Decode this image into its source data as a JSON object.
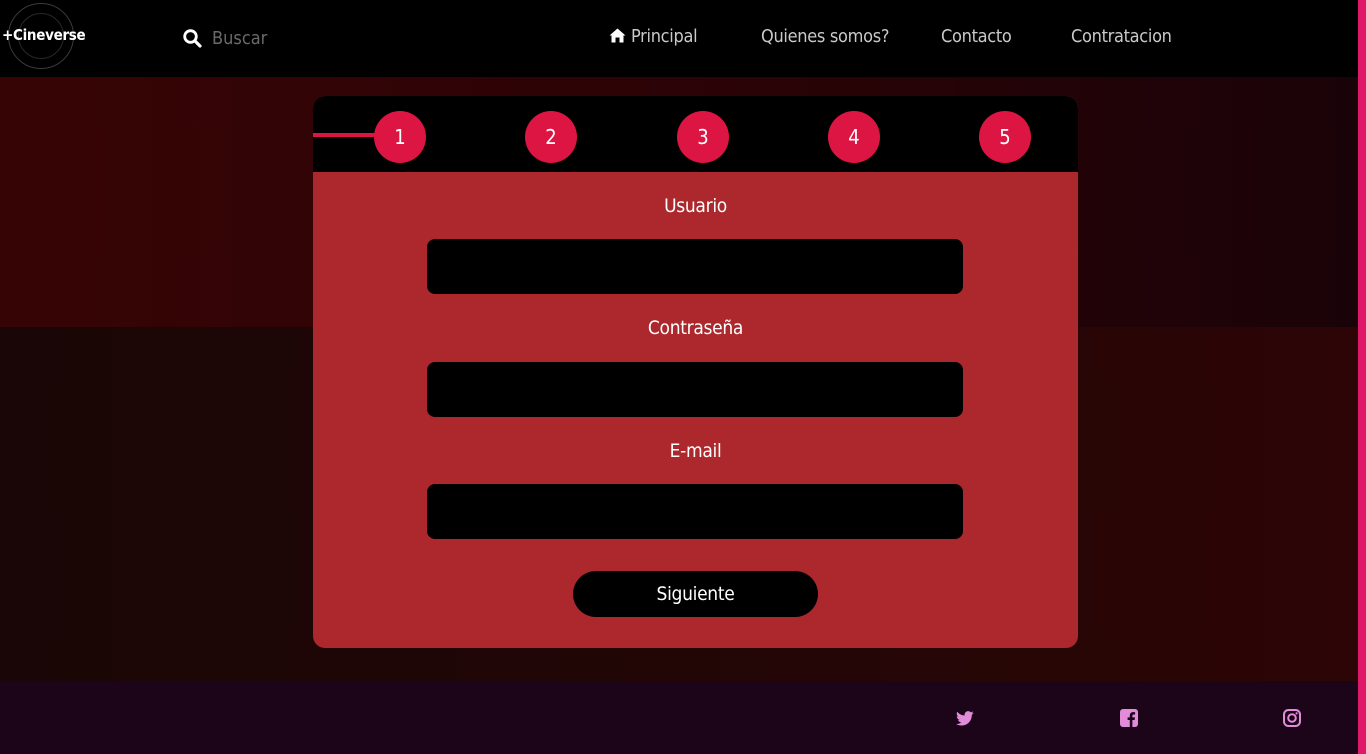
{
  "brand": {
    "logo_text": "+Cineverse"
  },
  "search": {
    "placeholder": "Buscar"
  },
  "nav": {
    "home": "Principal",
    "about": "Quienes somos?",
    "contact": "Contacto",
    "hire": "Contratacion"
  },
  "steps": [
    "1",
    "2",
    "3",
    "4",
    "5"
  ],
  "current_step": 1,
  "form": {
    "user_label": "Usuario",
    "user_value": "",
    "password_label": "Contraseña",
    "password_value": "",
    "email_label": "E-mail",
    "email_value": "",
    "next_label": "Siguiente"
  },
  "footer": {
    "social_icons": [
      "twitter-icon",
      "facebook-icon",
      "instagram-icon"
    ],
    "icon_color": "#e08cd9"
  },
  "colors": {
    "accent": "#dc1543",
    "card": "#ac282d",
    "scrollbar": "#e0186a"
  }
}
